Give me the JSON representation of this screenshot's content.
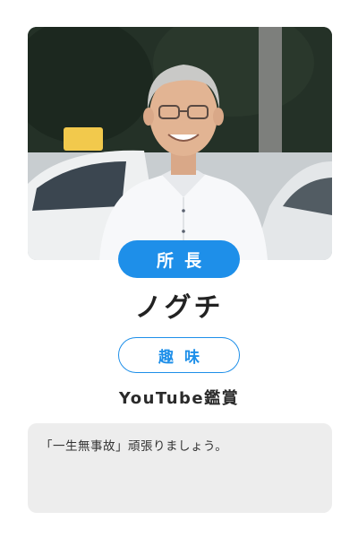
{
  "profile": {
    "role": "所長",
    "name": "ノグチ",
    "hobby_label": "趣味",
    "hobby_value": "YouTube鑑賞",
    "message": "「一生無事故」頑張りましょう。"
  },
  "colors": {
    "accent": "#1e8fe9",
    "message_bg": "#ededed",
    "text": "#222222"
  }
}
